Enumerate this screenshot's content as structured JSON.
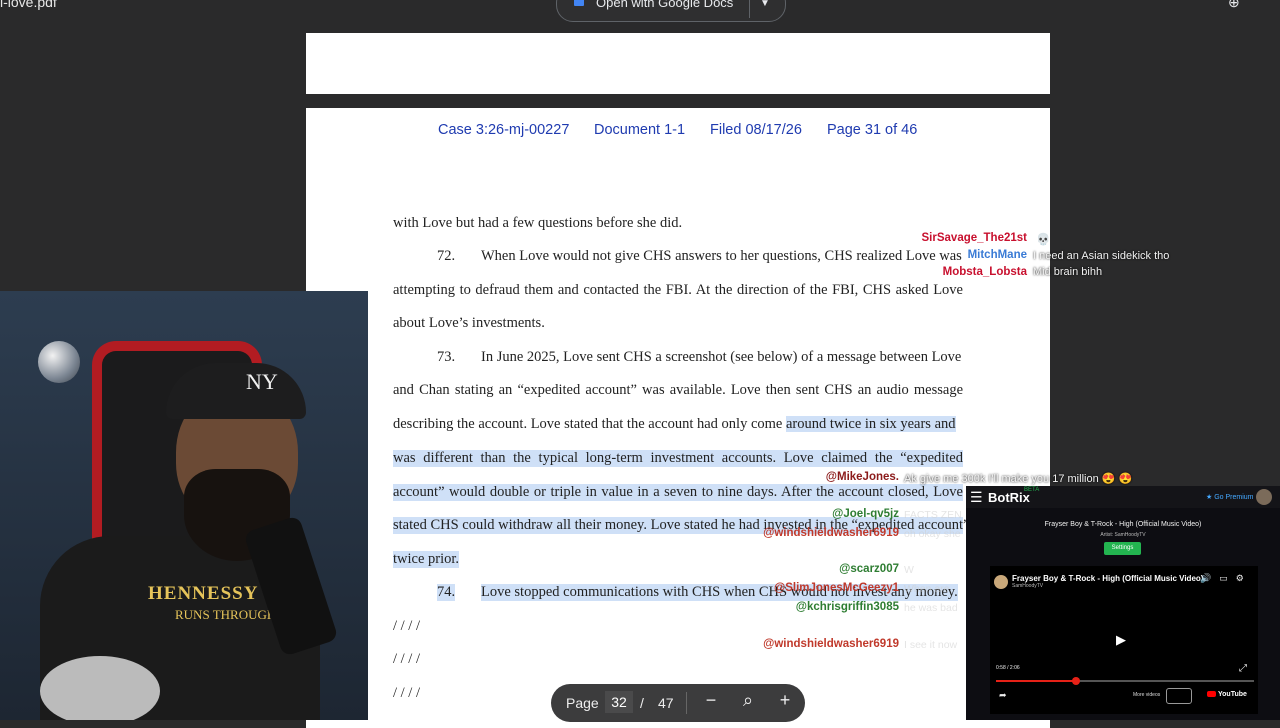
{
  "window": {
    "file_name": "i-love.pdf",
    "open_with_label": "Open with Google Docs",
    "open_with_icon": "google-docs-icon",
    "drive_icon": "add-to-drive-icon"
  },
  "pdf": {
    "header": {
      "case": "Case 3:26-mj-00227",
      "document": "Document 1-1",
      "filed": "Filed 08/17/26",
      "page": "Page 31 of 46"
    },
    "lines": [
      "with Love but had a few questions before she did.",
      "72.",
      "When Love would not give CHS answers to her questions, CHS realized Love was",
      "attempting to defraud them and contacted the FBI. At the direction of the FBI, CHS asked Love",
      "about Love’s investments.",
      "73.",
      "In June 2025, Love sent CHS a screenshot (see below) of a message between Love",
      "and Chan stating an “expedited account” was available. Love then sent CHS an audio message",
      "describing the account. Love stated that the account had only come ",
      "around twice in six years and",
      "was different than the typical long-term investment accounts. Love claimed the “expedited",
      "account” would double or triple in value in a seven to nine days. After the account closed, Love",
      "stated CHS could withdraw all their money. Love stated he had invested in the “expedited account”",
      "twice prior.",
      "74.",
      "Love stopped communications with CHS when CHS would not invest any money.",
      "/ / / /",
      "/ / / /",
      "/ / / /"
    ]
  },
  "toolbar": {
    "page_label": "Page",
    "current_page": "32",
    "separator": "/",
    "total_pages": "47",
    "zoom_out": "−",
    "zoom_in": "+"
  },
  "webcam": {
    "cap_logo": "NY",
    "shirt_text": "HENNESSY",
    "shirt_subtext": "RUNS THROUGH MY"
  },
  "chat": [
    {
      "user": "SirSavage_The21st",
      "color": "#c8102e",
      "message": "",
      "faint": ""
    },
    {
      "user": "MitchMane",
      "color": "#3a7bd5",
      "message": "I need an Asian sidekick tho",
      "faint": ""
    },
    {
      "user": "Mobsta_Lobsta",
      "color": "#c8102e",
      "message": "Mid brain bihh",
      "faint": ""
    },
    {
      "user": "@MikeJones.",
      "color": "#8b1a1a",
      "message": "Ak give me 300k I'll make you 17 million 😍 😍",
      "faint": ""
    },
    {
      "user": "@Joel-qv5jz",
      "color": "#2e7d32",
      "message": "",
      "faint": "FACTS ZEN"
    },
    {
      "user": "@windshieldwasher6919",
      "color": "#c0392b",
      "message": "",
      "faint": "oh okay she"
    },
    {
      "user": "@scarz007",
      "color": "#2e7d32",
      "message": "",
      "faint": "W"
    },
    {
      "user": "@SlimJonesMcGeezy1",
      "color": "#c0392b",
      "message": "",
      "faint": "When are"
    },
    {
      "user": "@kchrisgriffin3085",
      "color": "#2e7d32",
      "message": "",
      "faint": "he was bad"
    },
    {
      "user": "@windshieldwasher6919",
      "color": "#c0392b",
      "message": "",
      "faint": "I see it now"
    }
  ],
  "botrix": {
    "brand": "BotRix",
    "beta": "BETA",
    "premium": "★ Go Premium",
    "now_playing": "Frayser Boy & T-Rock - High (Official Music Video)",
    "artist": "Artist: SamHoodyTV",
    "settings": "Settings",
    "video_title": "Frayser Boy & T-Rock - High (Official Music Video)",
    "channel": "SamHoodyTV",
    "time": "0:58 / 2:06",
    "more_videos": "More videos",
    "youtube": "YouTube",
    "progress": 0.31
  },
  "colors": {
    "background": "#2a2a2b",
    "header_blue": "#1f3bb0",
    "highlight": "#cfe0f7",
    "botrix_green": "#23b450",
    "yt_red": "#e62117"
  }
}
